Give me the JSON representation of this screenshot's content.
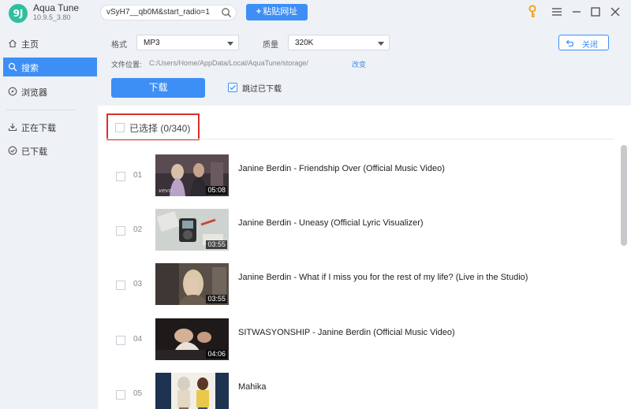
{
  "app": {
    "name": "Aqua Tune",
    "version": "10.9.5_3.80",
    "logo_text": "9J"
  },
  "toolbar": {
    "url_value": "vSyH7__qb0M&start_radio=1",
    "paste_label": "粘贴网址"
  },
  "sidebar": {
    "items": [
      {
        "label": "主页",
        "icon": "home-icon",
        "active": false
      },
      {
        "label": "搜索",
        "icon": "search-icon",
        "active": true
      },
      {
        "label": "浏览器",
        "icon": "compass-icon",
        "active": false
      },
      {
        "label": "正在下载",
        "icon": "download-icon",
        "active": false
      },
      {
        "label": "已下载",
        "icon": "check-circle-icon",
        "active": false
      }
    ]
  },
  "settings": {
    "format_label": "格式",
    "format_value": "MP3",
    "quality_label": "质量",
    "quality_value": "320K",
    "path_label": "文件位置:",
    "path_value": "C:/Users/Home/AppData/Local/AquaTune/storage/",
    "change_label": "改变",
    "close_label": "关闭",
    "download_label": "下载",
    "skip_label": "跳过已下载",
    "skip_checked": true
  },
  "list": {
    "select_all_label": "已选择 (0/340)",
    "rows": [
      {
        "num": "01",
        "title": "Janine Berdin - Friendship Over (Official Music Video)",
        "duration": "05:08"
      },
      {
        "num": "02",
        "title": "Janine Berdin - Uneasy (Official Lyric Visualizer)",
        "duration": "03:55"
      },
      {
        "num": "03",
        "title": "Janine Berdin - What if I miss you for the rest of my life? (Live in the Studio)",
        "duration": "03:55"
      },
      {
        "num": "04",
        "title": "SITWASYONSHIP - Janine Berdin (Official Music Video)",
        "duration": "04:06"
      },
      {
        "num": "05",
        "title": "Mahika",
        "duration": ""
      }
    ]
  },
  "colors": {
    "accent": "#3d8ff5",
    "highlight_border": "#d8322a",
    "panel_bg": "#eef1f5"
  }
}
